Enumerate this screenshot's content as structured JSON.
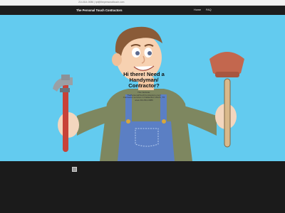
{
  "topbar": {
    "contact_text": "214-814-0086 | tpt@thepersonaltouch.com"
  },
  "navbar": {
    "brand": "The Personal Touch Contractors",
    "links": [
      "Home",
      "FAQ"
    ]
  },
  "hero": {
    "headline": "Hi there! Need a Handyman/ Contractor?",
    "subtext": "This Website: ThePersonalTouchContractors.com/ Contractor services in Dallas/Fort Worth, TX area 214-814-0086",
    "colors": {
      "background": "#63cbef"
    }
  },
  "footer": {
    "icon": "image-icon"
  }
}
